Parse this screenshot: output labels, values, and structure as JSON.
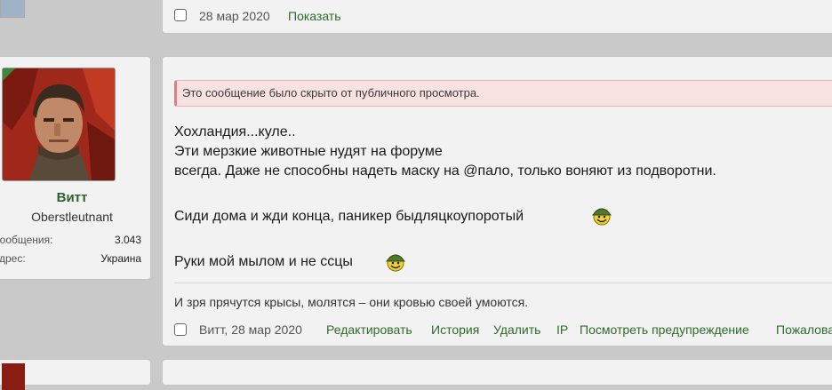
{
  "prev_post": {
    "date": "28 мар 2020",
    "show_link": "Показать"
  },
  "user": {
    "name": "Витт",
    "title": "Oberstleutnant",
    "stats": [
      {
        "label": "Сообщения:",
        "value": "3.043"
      },
      {
        "label": "Адрес:",
        "value": "Украина"
      }
    ]
  },
  "post": {
    "notice": "Это сообщение было скрыто от публичного просмотра.",
    "lines": [
      "Хохландия...куле..",
      "Эти мерзкие животные нудят на форуме",
      "всегда. Даже не способны надеть маску на @пало, только воняют из подворотни.",
      "Сиди дома и жди конца, паникер быдляцкоупоротый",
      "Руки мой мылом и не ссцы"
    ],
    "signature": "И зря прячутся крысы, молятся – они кровью своей умоются.",
    "footer": {
      "author_date": "Витт, 28 мар 2020",
      "actions": [
        "Редактировать",
        "История",
        "Удалить",
        "IP",
        "Посмотреть предупреждение",
        "Пожаловаться"
      ]
    }
  },
  "icons": {
    "smiley_1": "soldier-smiley-icon",
    "smiley_2": "soldier-smiley-icon"
  },
  "colors": {
    "link": "#2f6b2a",
    "username": "#2e5e2e",
    "notice_bg": "#f8e1e1",
    "notice_border": "#d98080"
  }
}
